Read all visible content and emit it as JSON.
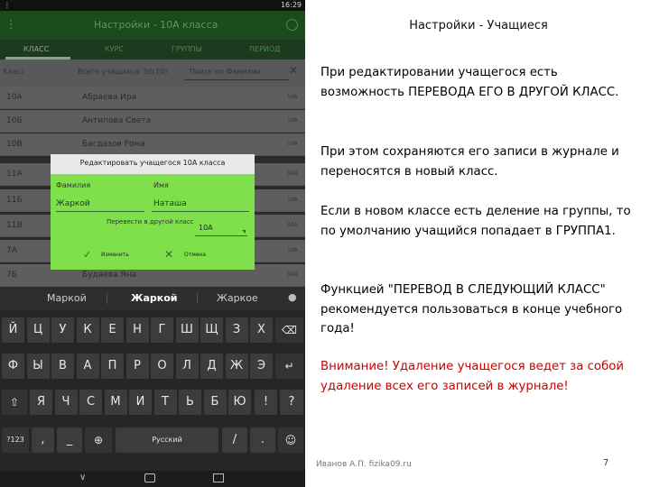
{
  "phone": {
    "status": {
      "left": "⋮",
      "time": "16:29"
    },
    "appbar": {
      "title": "Настройки - 10А класса",
      "menu_icon": "menu-icon",
      "info_icon": "info-icon"
    },
    "tabs": [
      "КЛАСС",
      "КУРС",
      "ГРУППЫ",
      "ПЕРИОД"
    ],
    "filter": {
      "class_label": "Класс",
      "total_label": "Всего учащихся: 56(10)",
      "search_placeholder": "Поиск по Фамилии",
      "clear": "✕"
    },
    "rows": [
      {
        "class": "10А",
        "name": "Абраева Ира",
        "sub": "10А"
      },
      {
        "class": "10Б",
        "name": "Антипова Света",
        "sub": "10А"
      },
      {
        "class": "10В",
        "name": "Багдазов Рома",
        "sub": "10А"
      },
      {
        "class": "11А",
        "name": "",
        "sub": "10А"
      },
      {
        "class": "11Б",
        "name": "",
        "sub": "10А"
      },
      {
        "class": "11В",
        "name": "",
        "sub": "10А"
      },
      {
        "class": "7А",
        "name": "",
        "sub": "10А"
      },
      {
        "class": "7Б",
        "name": "Будаева Яна",
        "sub": "10А"
      }
    ],
    "dialog": {
      "title": "Редактировать учащегося 10А класса",
      "surname_label": "Фамилия",
      "name_label": "Имя",
      "surname_value": "Жаркой",
      "name_value": "Наташа",
      "transfer_label": "Перевести в другой класс",
      "transfer_value": "10А",
      "save_label": "Изменить",
      "cancel_label": "Отмена"
    },
    "keyboard": {
      "suggestions": [
        "Маркой",
        "Жаркой",
        "Жаркое"
      ],
      "row1": [
        "Й",
        "Ц",
        "У",
        "К",
        "Е",
        "Н",
        "Г",
        "Ш",
        "Щ",
        "З",
        "Х"
      ],
      "row2": [
        "Ф",
        "Ы",
        "В",
        "А",
        "П",
        "Р",
        "О",
        "Л",
        "Д",
        "Ж",
        "Э"
      ],
      "row3": [
        "Я",
        "Ч",
        "С",
        "М",
        "И",
        "Т",
        "Ь",
        "Б",
        "Ю"
      ],
      "extra": {
        "backspace": "⌫",
        "enter": "↵",
        "shift": "⇧",
        "exclaim": "!",
        "question": "?",
        "mode": "?123",
        "comma": ",",
        "underscore": "_",
        "globe": "⊕",
        "space": "Русский",
        "slash": "/",
        "dot": ".",
        "emoji": "☺"
      }
    },
    "navbar": {
      "back": "∨"
    }
  },
  "slide": {
    "title": "Настройки - Учащиеся",
    "paragraphs": [
      "При редактировании учащегося есть возможность ПЕРЕВОДА ЕГО В ДРУГОЙ КЛАСС.",
      "При этом сохраняются его записи в журнале и переносятся в новый класс.",
      "Если в новом классе есть деление на группы, то по умолчанию учащийся попадает в ГРУППА1.",
      "Функцией \"ПЕРЕВОД В СЛЕДУЮЩИЙ КЛАСС\" рекомендуется пользоваться в конце учебного года!"
    ],
    "warning": "Внимание! Удаление учащегося ведет за собой удаление всех его записей в журнале!",
    "footer": "Иванов А.П. fizika09.ru",
    "page_number": "7"
  }
}
